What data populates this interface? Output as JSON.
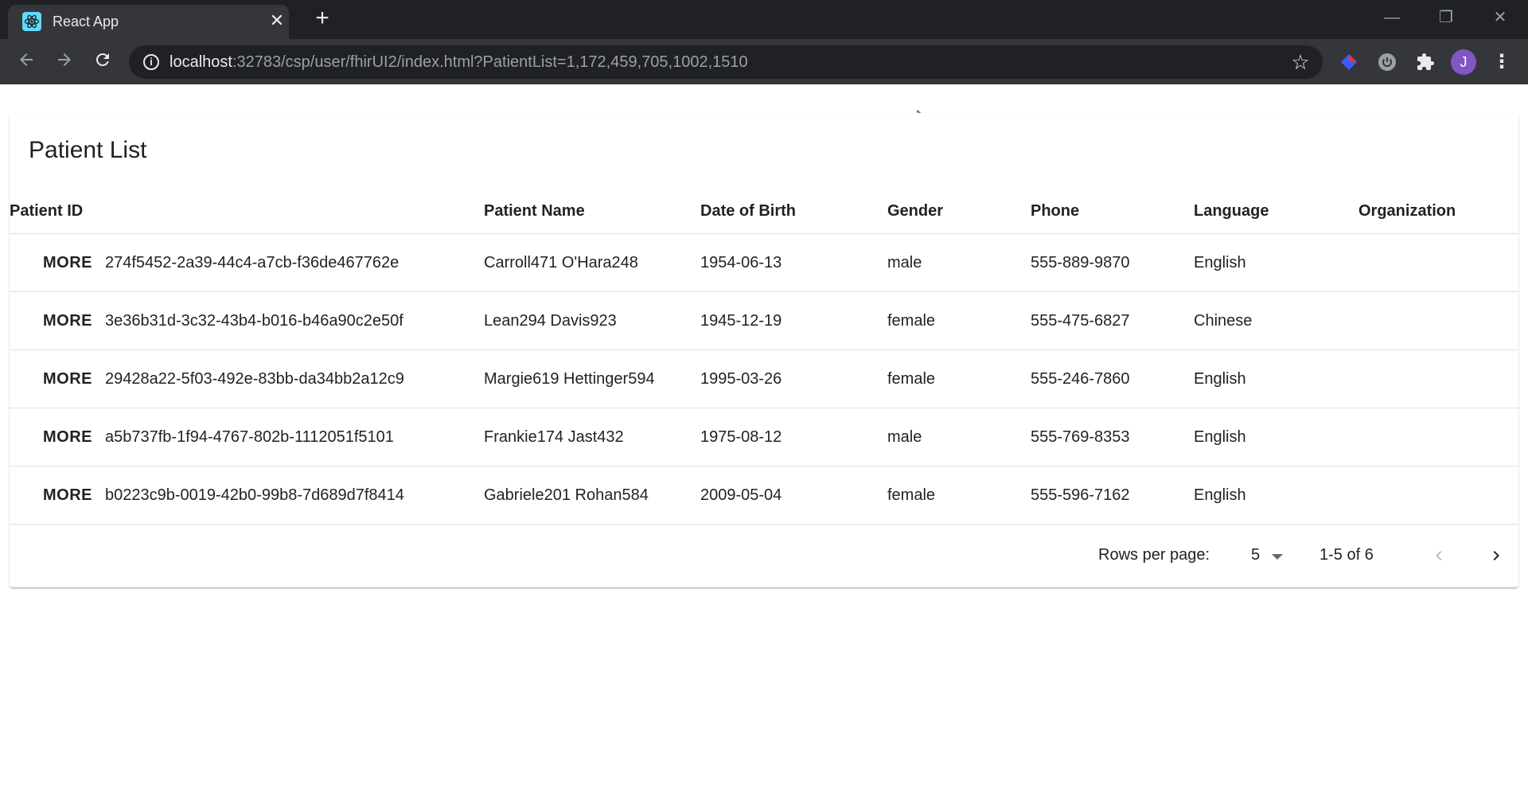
{
  "browser": {
    "tab_title": "React App",
    "url_host": "localhost",
    "url_rest": ":32783/csp/user/fhirUI2/index.html?PatientList=1,172,459,705,1002,1510",
    "profile_initial": "J",
    "colors": {
      "tabstrip": "#202124",
      "toolbar": "#35363a",
      "avatar": "#7e57c2",
      "favicon": "#61dafb"
    }
  },
  "page": {
    "title": "Patient List",
    "columns": [
      "Patient ID",
      "Patient Name",
      "Date of Birth",
      "Gender",
      "Phone",
      "Language",
      "Organization"
    ],
    "more_label": "MORE",
    "rows": [
      {
        "id": "274f5452-2a39-44c4-a7cb-f36de467762e",
        "name": "Carroll471 O'Hara248",
        "dob": "1954-06-13",
        "gender": "male",
        "phone": "555-889-9870",
        "language": "English",
        "organization": ""
      },
      {
        "id": "3e36b31d-3c32-43b4-b016-b46a90c2e50f",
        "name": "Lean294 Davis923",
        "dob": "1945-12-19",
        "gender": "female",
        "phone": "555-475-6827",
        "language": "Chinese",
        "organization": ""
      },
      {
        "id": "29428a22-5f03-492e-83bb-da34bb2a12c9",
        "name": "Margie619 Hettinger594",
        "dob": "1995-03-26",
        "gender": "female",
        "phone": "555-246-7860",
        "language": "English",
        "organization": ""
      },
      {
        "id": "a5b737fb-1f94-4767-802b-1112051f5101",
        "name": "Frankie174 Jast432",
        "dob": "1975-08-12",
        "gender": "male",
        "phone": "555-769-8353",
        "language": "English",
        "organization": ""
      },
      {
        "id": "b0223c9b-0019-42b0-99b8-7d689d7f8414",
        "name": "Gabriele201 Rohan584",
        "dob": "2009-05-04",
        "gender": "female",
        "phone": "555-596-7162",
        "language": "English",
        "organization": ""
      }
    ],
    "pagination": {
      "rows_per_page_label": "Rows per page:",
      "rows_per_page_value": "5",
      "range_text": "1-5 of 6"
    }
  },
  "icons": {
    "tab_close": "close-icon",
    "new_tab": "plus-icon",
    "back": "arrow-left-icon",
    "forward": "arrow-right-icon",
    "reload": "reload-icon",
    "site_info": "info-icon",
    "bookmark": "star-icon",
    "extensions": "puzzle-icon",
    "prev_page": "chevron-left-icon",
    "next_page": "chevron-right-icon"
  }
}
